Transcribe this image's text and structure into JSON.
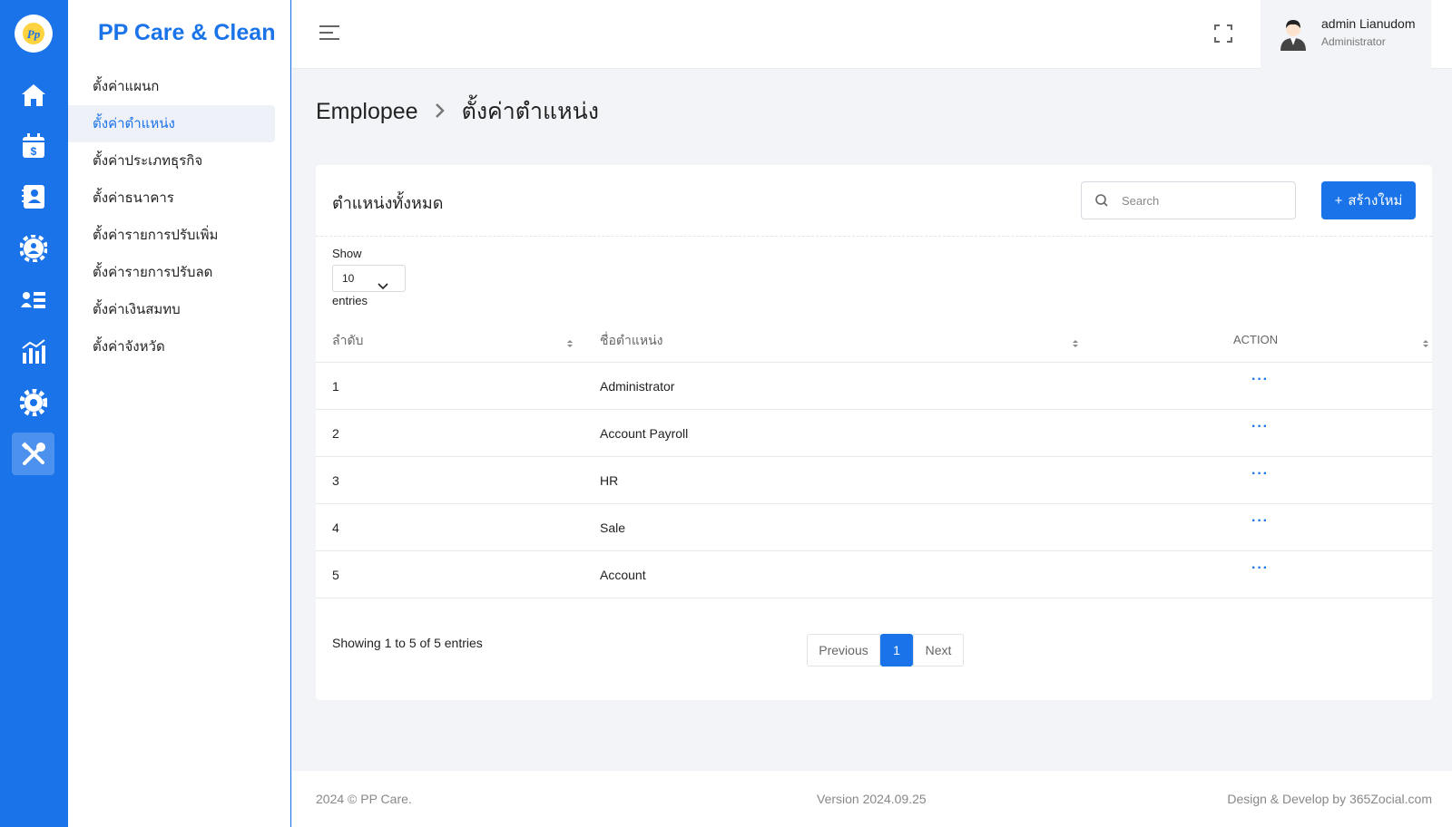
{
  "brand": "PP Care & Clean",
  "rail": {
    "items": [
      {
        "icon": "home-icon"
      },
      {
        "icon": "payroll-calendar-icon"
      },
      {
        "icon": "contacts-icon"
      },
      {
        "icon": "team-settings-icon"
      },
      {
        "icon": "employee-list-icon"
      },
      {
        "icon": "report-chart-icon"
      },
      {
        "icon": "gear-icon"
      },
      {
        "icon": "tools-icon",
        "active": true
      }
    ]
  },
  "submenu": {
    "items": [
      {
        "label": "ตั้งค่าแผนก"
      },
      {
        "label": "ตั้งค่าตำแหน่ง",
        "active": true
      },
      {
        "label": "ตั้งค่าประเภทธุรกิจ"
      },
      {
        "label": "ตั้งค่าธนาคาร"
      },
      {
        "label": "ตั้งค่ารายการปรับเพิ่ม"
      },
      {
        "label": "ตั้งค่ารายการปรับลด"
      },
      {
        "label": "ตั้งค่าเงินสมทบ"
      },
      {
        "label": "ตั้งค่าจังหวัด"
      }
    ]
  },
  "header": {
    "user_name": "admin Lianudom",
    "user_role": "Administrator"
  },
  "breadcrumb": {
    "parent": "Emplopee",
    "current": "ตั้งค่าตำแหน่ง"
  },
  "card": {
    "title": "ตำแหน่งทั้งหมด",
    "search_placeholder": "Search",
    "search_value": "",
    "create_label": "สร้างใหม่",
    "show_label": "Show",
    "page_size": "10",
    "entries_label": "entries",
    "columns": [
      "ลำดับ",
      "ชื่อตำแหน่ง",
      "ACTION"
    ],
    "rows": [
      {
        "no": "1",
        "name": "Administrator",
        "action": "···"
      },
      {
        "no": "2",
        "name": "Account Payroll",
        "action": "···"
      },
      {
        "no": "3",
        "name": "HR",
        "action": "···"
      },
      {
        "no": "4",
        "name": "Sale",
        "action": "···"
      },
      {
        "no": "5",
        "name": "Account",
        "action": "···"
      }
    ],
    "showing": "Showing 1 to 5 of 5 entries",
    "pager": {
      "previous": "Previous",
      "current": "1",
      "next": "Next"
    }
  },
  "footer": {
    "copyright": "2024 © PP Care.",
    "version": "Version 2024.09.25",
    "credit": "Design & Develop by 365Zocial.com"
  },
  "colors": {
    "primary": "#1a73e8",
    "background": "#f3f4f8"
  }
}
